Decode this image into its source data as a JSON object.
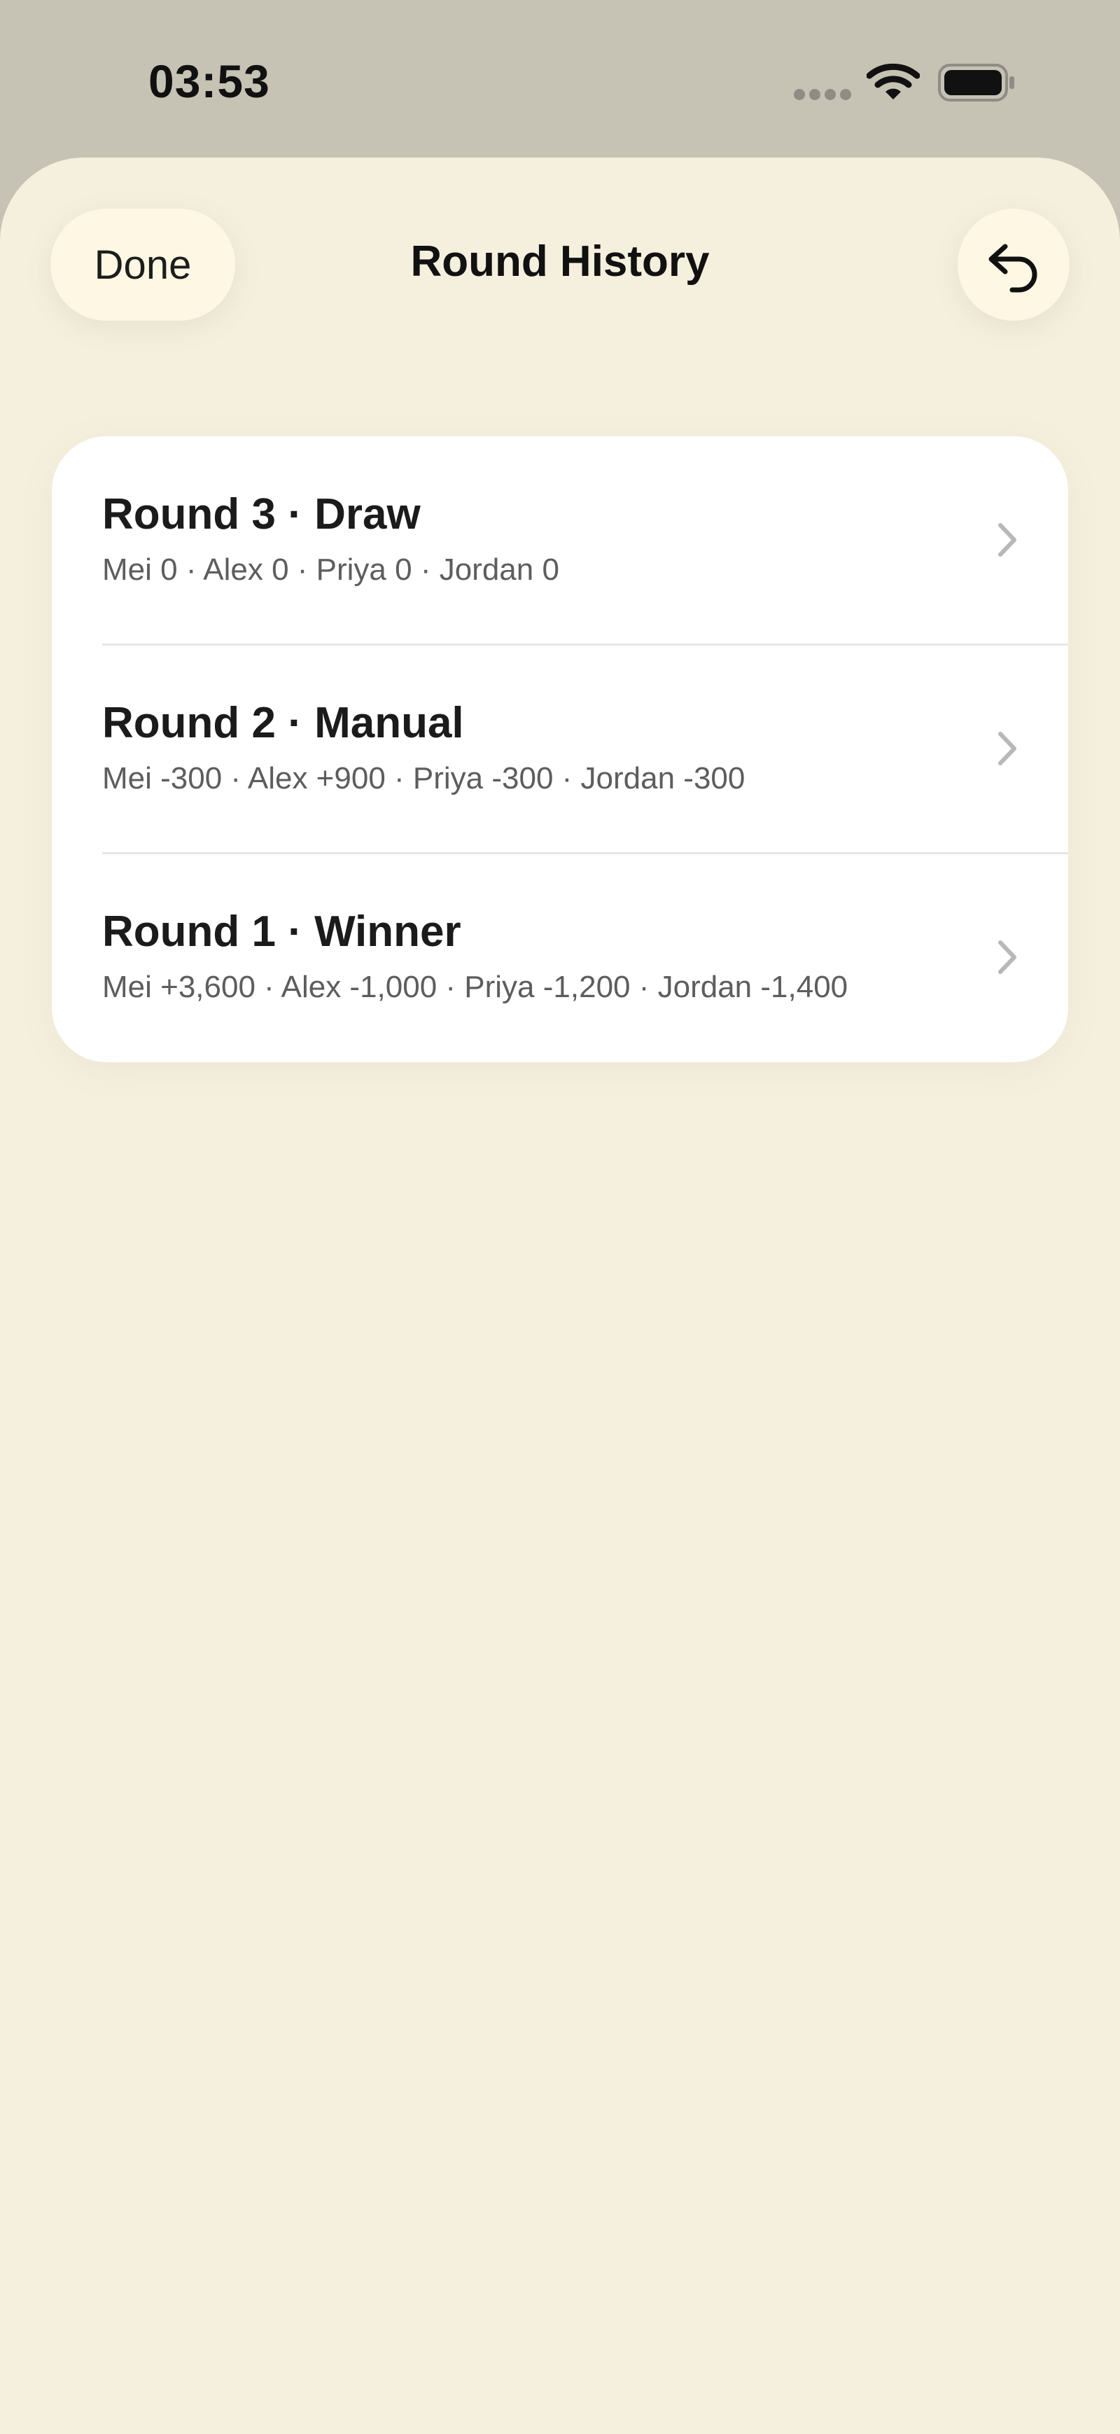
{
  "status_bar": {
    "time": "03:53",
    "signal_icon": "cellular-signal-icon",
    "wifi_icon": "wifi-icon",
    "battery_icon": "battery-icon"
  },
  "header": {
    "done_label": "Done",
    "title": "Round History",
    "undo_icon": "undo-arrow-icon"
  },
  "rounds": [
    {
      "title": "Round 3 · Draw",
      "detail": "Mei 0 · Alex 0 · Priya 0 · Jordan 0"
    },
    {
      "title": "Round 2 · Manual",
      "detail": "Mei -300 · Alex +900 · Priya -300 · Jordan -300"
    },
    {
      "title": "Round 1 · Winner",
      "detail": "Mei +3,600 · Alex -1,000 · Priya -1,200 · Jordan -1,400"
    }
  ],
  "colors": {
    "sheet_background": "#f5efde",
    "status_background": "#c6c2b4",
    "button_background": "#fdf7e3",
    "card_background": "#ffffff"
  }
}
